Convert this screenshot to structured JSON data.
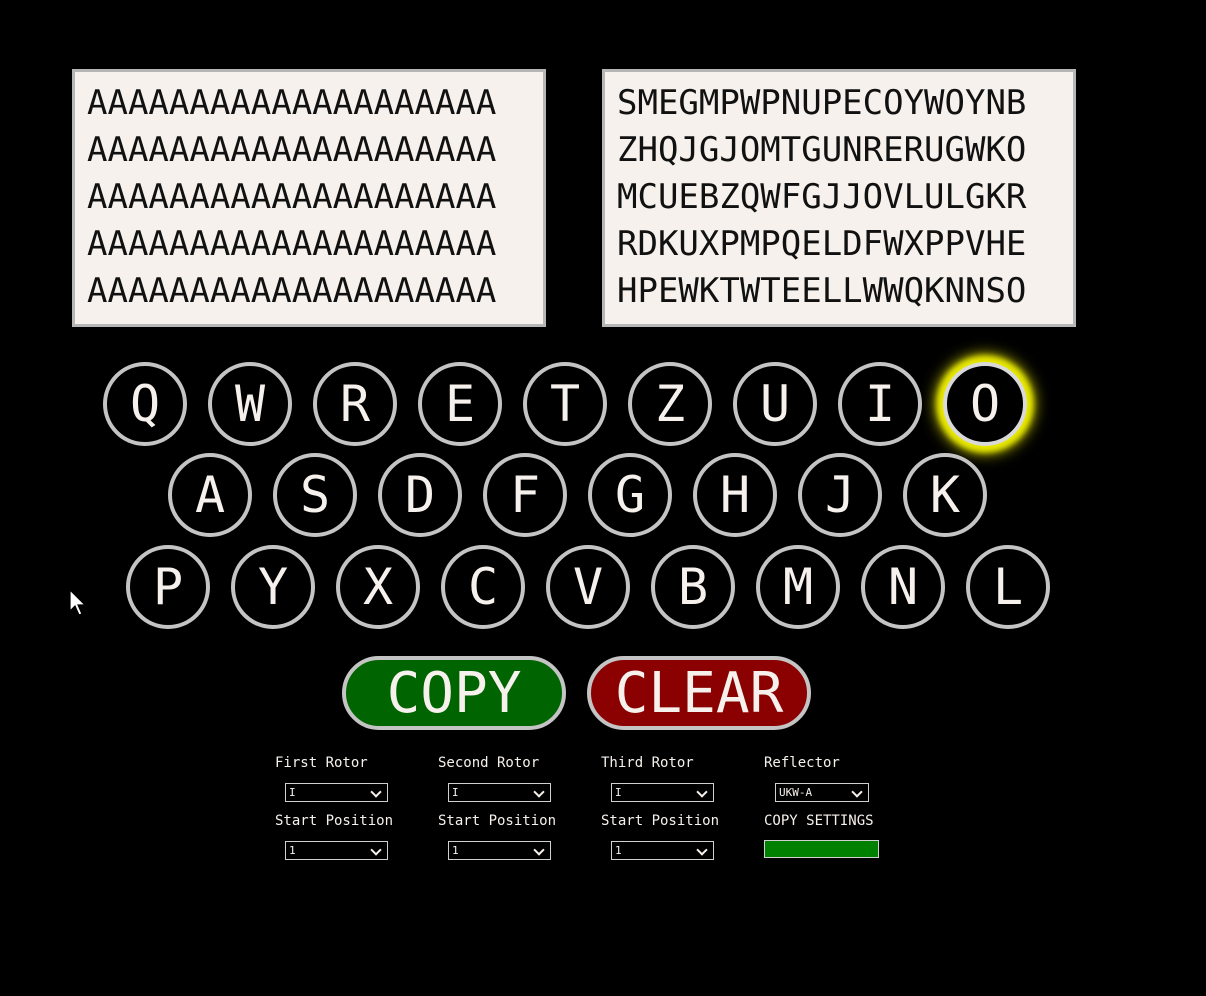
{
  "input_text": {
    "lines": [
      "AAAAAAAAAAAAAAAAAAAA",
      "AAAAAAAAAAAAAAAAAAAA",
      "AAAAAAAAAAAAAAAAAAAA",
      "AAAAAAAAAAAAAAAAAAAA",
      "AAAAAAAAAAAAAAAAAAAA"
    ]
  },
  "output_text": {
    "lines": [
      "SMEGMPWPNUPECOYWOYNB",
      "ZHQJGJOMTGUNRERUGWKO",
      "MCUEBZQWFGJJOVLULGKR",
      "RDKUXPMPQELDFWXPPVHE",
      "HPEWKTWTEELLWWQKNNSO"
    ]
  },
  "keyboard": {
    "row1": [
      "Q",
      "W",
      "R",
      "E",
      "T",
      "Z",
      "U",
      "I",
      "O"
    ],
    "row2": [
      "A",
      "S",
      "D",
      "F",
      "G",
      "H",
      "J",
      "K"
    ],
    "row3": [
      "P",
      "Y",
      "X",
      "C",
      "V",
      "B",
      "M",
      "N",
      "L"
    ],
    "lit_key": "O",
    "lit_color": "#e8e800"
  },
  "buttons": {
    "copy_label": "COPY",
    "copy_color": "#006400",
    "clear_label": "CLEAR",
    "clear_color": "#8b0000"
  },
  "settings": {
    "first_rotor": {
      "label": "First Rotor",
      "value": "I"
    },
    "second_rotor": {
      "label": "Second Rotor",
      "value": "I"
    },
    "third_rotor": {
      "label": "Third Rotor",
      "value": "I"
    },
    "reflector": {
      "label": "Reflector",
      "value": "UKW-A"
    },
    "first_start": {
      "label": "Start Position",
      "value": "1"
    },
    "second_start": {
      "label": "Start Position",
      "value": "1"
    },
    "third_start": {
      "label": "Start Position",
      "value": "1"
    },
    "copy_settings": {
      "label": "COPY SETTINGS",
      "color": "#008000"
    }
  }
}
